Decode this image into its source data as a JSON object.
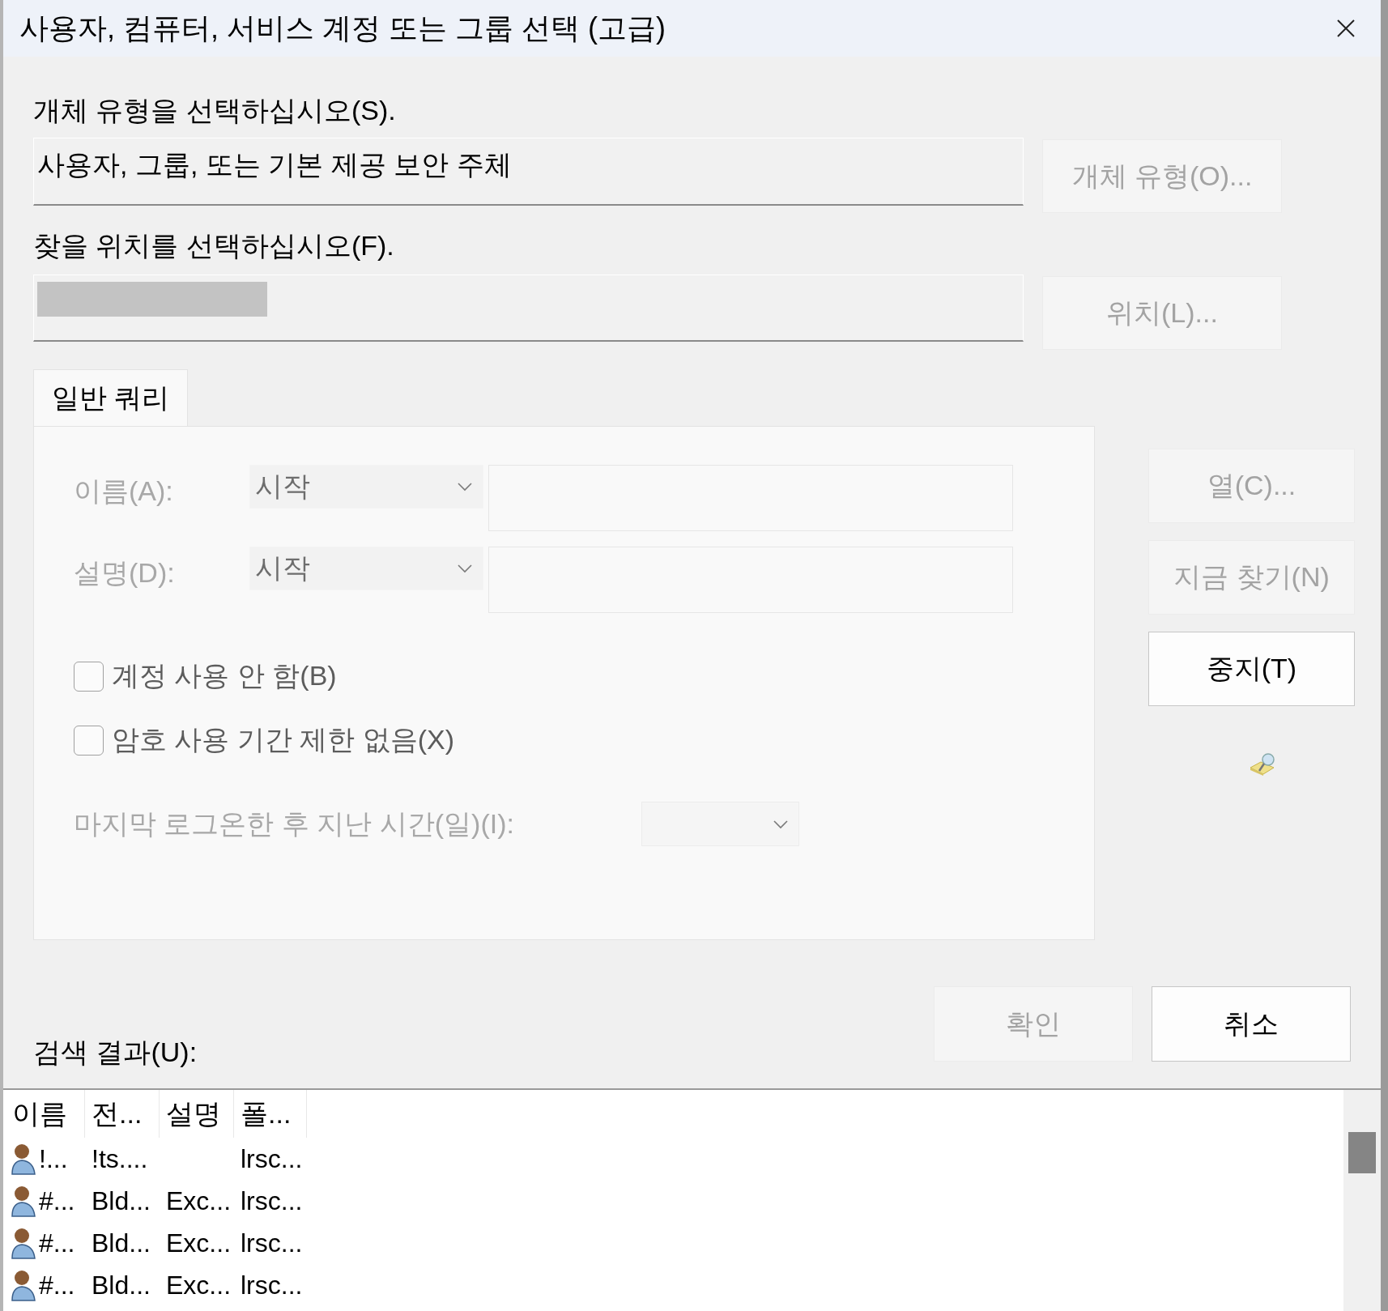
{
  "window": {
    "title": "사용자, 컴퓨터, 서비스 계정 또는 그룹 선택 (고급)"
  },
  "object_type": {
    "label": "개체 유형을 선택하십시오(S).",
    "value": "사용자, 그룹, 또는 기본 제공 보안 주체",
    "button": {
      "label": "개체 유형(O)...",
      "disabled": true
    }
  },
  "location": {
    "label": "찾을 위치를 선택하십시오(F).",
    "button": {
      "label": "위치(L)...",
      "disabled": true
    }
  },
  "tabs": [
    {
      "label": "일반 쿼리",
      "selected": true
    }
  ],
  "query": {
    "fields": [
      {
        "label": "이름(A):",
        "mode": "시작",
        "disabled": true
      },
      {
        "label": "설명(D):",
        "mode": "시작",
        "disabled": true
      }
    ],
    "checkboxes": [
      {
        "label": "계정 사용 안 함(B)",
        "checked": false
      },
      {
        "label": "암호 사용 기간 제한 없음(X)",
        "checked": false
      }
    ],
    "last_logon": {
      "label": "마지막 로그온한 후 지난 시간(일)(I):",
      "disabled": true
    }
  },
  "side_buttons": [
    {
      "label": "열(C)...",
      "disabled": true
    },
    {
      "label": "지금 찾기(N)",
      "disabled": true
    },
    {
      "label": "중지(T)",
      "disabled": false
    }
  ],
  "dialog_buttons": [
    {
      "label": "확인",
      "disabled": true
    },
    {
      "label": "취소",
      "disabled": false
    }
  ],
  "results": {
    "label": "검색 결과(U):",
    "columns": [
      "이름",
      "전...",
      "설명",
      "폴..."
    ],
    "rows": [
      {
        "name": "!...",
        "column_2": "!ts....",
        "column_4": "lrsc..."
      },
      {
        "name": "#...",
        "column_2": "Bld...",
        "description": "Exc...",
        "column_4": "lrsc..."
      },
      {
        "name": "#...",
        "column_2": "Bld...",
        "description": "Exc...",
        "column_4": "lrsc..."
      },
      {
        "name": "#...",
        "column_2": "Bld...",
        "description": "Exc...",
        "column_4": "lrsc..."
      }
    ]
  }
}
